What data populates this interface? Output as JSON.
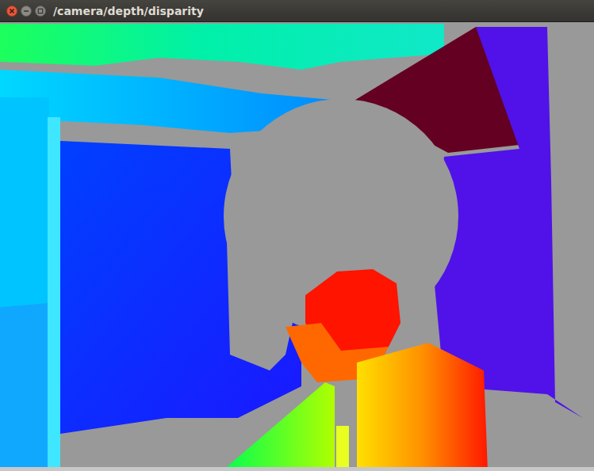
{
  "window": {
    "title": "/camera/depth/disparity"
  }
}
